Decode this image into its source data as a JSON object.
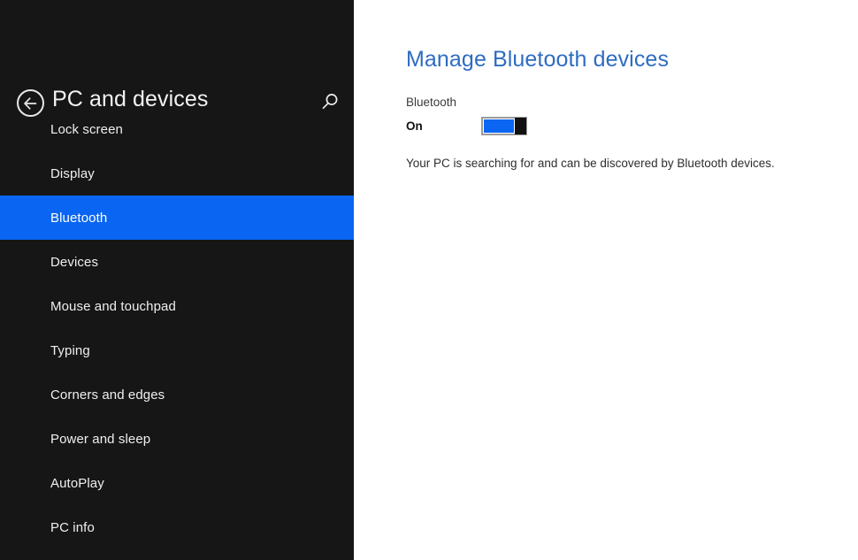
{
  "sidebar": {
    "back_button": {
      "icon": "back-arrow-circle-icon",
      "label": "Back"
    },
    "title": "PC and devices",
    "search": {
      "icon": "search-icon",
      "label": "Search"
    },
    "items": [
      {
        "label": "Lock screen",
        "selected": false
      },
      {
        "label": "Display",
        "selected": false
      },
      {
        "label": "Bluetooth",
        "selected": true
      },
      {
        "label": "Devices",
        "selected": false
      },
      {
        "label": "Mouse and touchpad",
        "selected": false
      },
      {
        "label": "Typing",
        "selected": false
      },
      {
        "label": "Corners and edges",
        "selected": false
      },
      {
        "label": "Power and sleep",
        "selected": false
      },
      {
        "label": "AutoPlay",
        "selected": false
      },
      {
        "label": "PC info",
        "selected": false
      }
    ]
  },
  "content": {
    "page_title": "Manage Bluetooth devices",
    "bluetooth_setting": {
      "label": "Bluetooth",
      "state": "On",
      "toggle_on": true
    },
    "description": "Your PC is searching for and can be discovered by Bluetooth devices."
  },
  "colors": {
    "sidebar_background": "#161616",
    "accent_blue": "#0a66f2",
    "heading_blue": "#2f6cc2",
    "content_background": "#ffffff",
    "toggle_border": "#9b9b9b",
    "toggle_thumb": "#111111"
  }
}
